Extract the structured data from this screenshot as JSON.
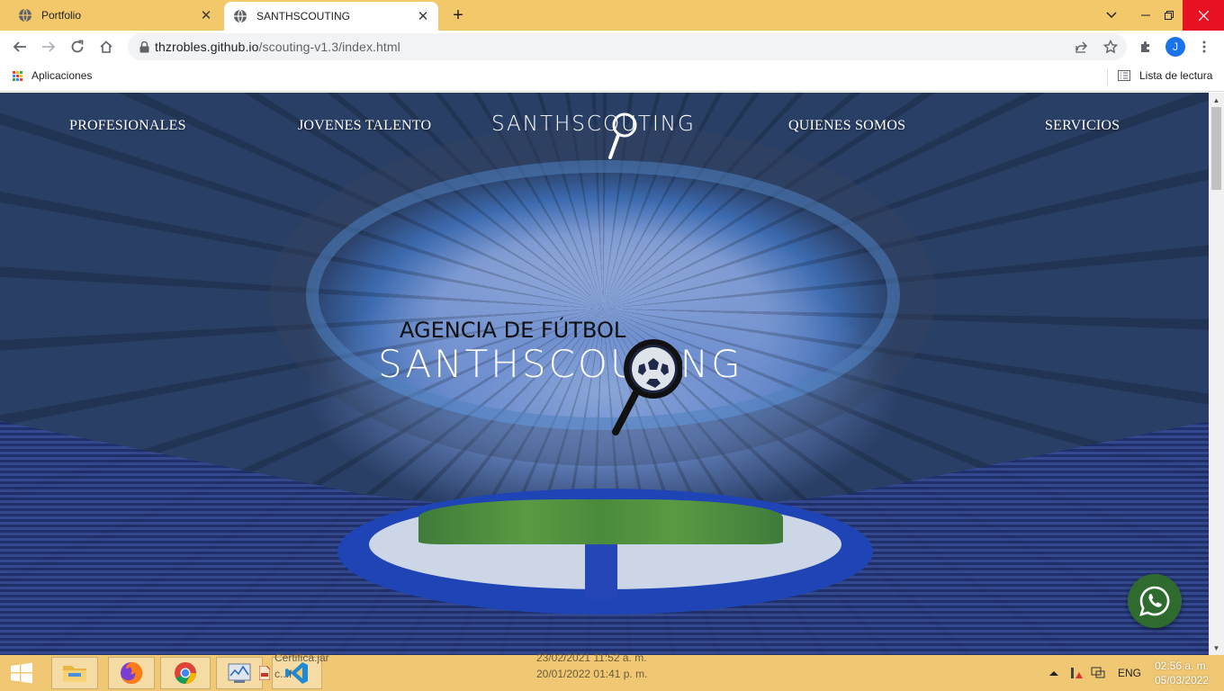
{
  "browser": {
    "tabs": [
      {
        "label": "Portfolio",
        "active": false
      },
      {
        "label": "SANTHSCOUTING",
        "active": true
      }
    ],
    "new_tab_symbol": "+",
    "close_symbol": "✕",
    "address": {
      "host": "thzrobles.github.io",
      "path": "/scouting-v1.3/index.html"
    },
    "profile_initial": "J",
    "bookmarks": {
      "apps_label": "Aplicaciones",
      "reading_list_label": "Lista de lectura"
    }
  },
  "site": {
    "nav": {
      "left": [
        "PROFESIONALES",
        "JOVENES TALENTO"
      ],
      "logo_text": "SANTHSCOUTING",
      "right": [
        "QUIENES SOMOS",
        "SERVICIOS"
      ]
    },
    "hero": {
      "subtitle": "AGENCIA DE FÚTBOL",
      "title": "SANTHSCOUTING"
    }
  },
  "taskbar": {
    "ghost_files": [
      {
        "name": "Certifica.jar",
        "date": "23/02/2021 11:52 a. m."
      },
      {
        "name": "c...f",
        "date": "20/01/2022 01:41 p. m."
      }
    ],
    "language": "ENG",
    "time": "02:56 a. m.",
    "date": "05/03/2022"
  },
  "colors": {
    "tab_strip": "#f2c86b",
    "taskbar": "#f0c873",
    "whatsapp": "#2f6b2f",
    "close_hover": "#e81123",
    "accent": "#1a73e8"
  }
}
